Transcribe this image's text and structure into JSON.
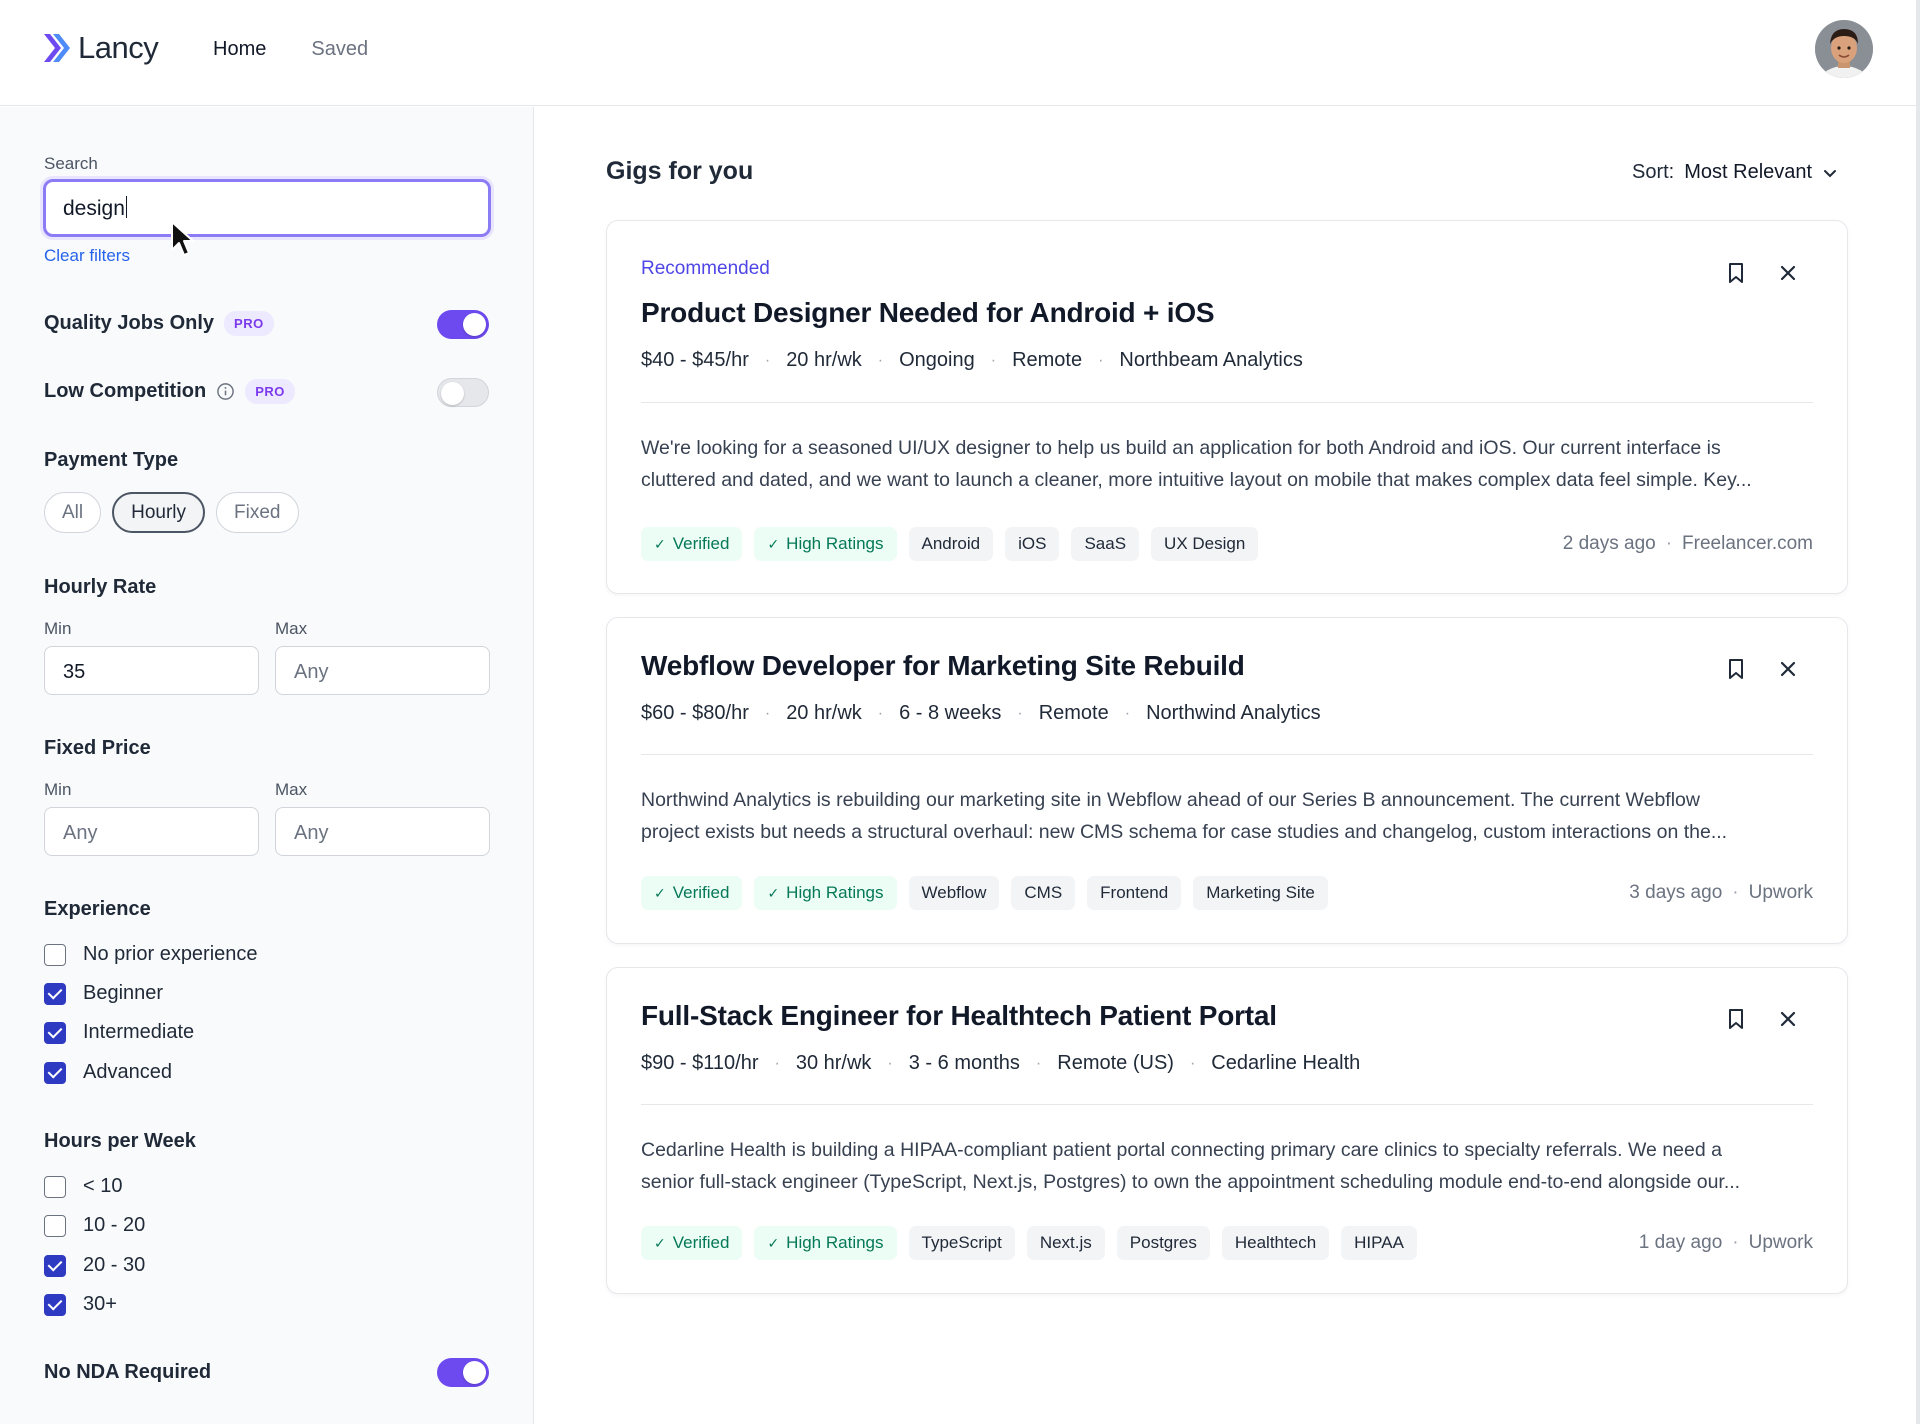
{
  "app": {
    "name": "Lancy"
  },
  "nav": {
    "items": [
      "Home",
      "Saved"
    ]
  },
  "filters": {
    "search_label": "Search",
    "search_value": "design",
    "clear_label": "Clear filters",
    "quality_label": "Quality Jobs Only",
    "quality_on": true,
    "low_comp_label": "Low Competition",
    "low_comp_on": false,
    "pro_badge": "PRO",
    "payment_title": "Payment Type",
    "payment_options": [
      "All",
      "Hourly",
      "Fixed"
    ],
    "payment_selected": "Hourly",
    "hourly_title": "Hourly Rate",
    "min_label": "Min",
    "max_label": "Max",
    "hourly_min": "35",
    "hourly_max_placeholder": "Any",
    "fixed_title": "Fixed Price",
    "fixed_min_placeholder": "Any",
    "fixed_max_placeholder": "Any",
    "experience_title": "Experience",
    "experience": [
      {
        "label": "No prior experience",
        "checked": false
      },
      {
        "label": "Beginner",
        "checked": true
      },
      {
        "label": "Intermediate",
        "checked": true
      },
      {
        "label": "Advanced",
        "checked": true
      }
    ],
    "hours_title": "Hours per Week",
    "hours": [
      {
        "label": "< 10",
        "checked": false
      },
      {
        "label": "10 - 20",
        "checked": false
      },
      {
        "label": "20 - 30",
        "checked": true
      },
      {
        "label": "30+",
        "checked": true
      }
    ],
    "nda_label": "No NDA Required",
    "nda_on": true
  },
  "main": {
    "title": "Gigs for you",
    "sort_label": "Sort:",
    "sort_value": "Most Relevant"
  },
  "gigs": [
    {
      "badge": "Recommended",
      "title": "Product Designer Needed for Android + iOS",
      "meta": [
        "$40 - $45/hr",
        "20 hr/wk",
        "Ongoing",
        "Remote",
        "Northbeam Analytics"
      ],
      "desc1": "We're looking for a seasoned UI/UX designer to help us build an application for both Android and iOS. Our current interface is",
      "desc2": "cluttered and dated, and we want to launch a cleaner, more intuitive layout on mobile that makes complex data feel simple. Key...",
      "badges": [
        "Verified",
        "High Ratings"
      ],
      "tags": [
        "Android",
        "iOS",
        "SaaS",
        "UX Design"
      ],
      "posted": "2 days ago",
      "source": "Freelancer.com"
    },
    {
      "title": "Webflow Developer for Marketing Site Rebuild",
      "meta": [
        "$60 - $80/hr",
        "20 hr/wk",
        "6 - 8 weeks",
        "Remote",
        "Northwind Analytics"
      ],
      "desc1": "Northwind Analytics is rebuilding our marketing site in Webflow ahead of our Series B announcement. The current Webflow",
      "desc2": "project exists but needs a structural overhaul: new CMS schema for case studies and changelog, custom interactions on the...",
      "badges": [
        "Verified",
        "High Ratings"
      ],
      "tags": [
        "Webflow",
        "CMS",
        "Frontend",
        "Marketing Site"
      ],
      "posted": "3 days ago",
      "source": "Upwork"
    },
    {
      "title": "Full-Stack Engineer for Healthtech Patient Portal",
      "meta": [
        "$90 - $110/hr",
        "30 hr/wk",
        "3 - 6 months",
        "Remote (US)",
        "Cedarline Health"
      ],
      "desc1": "Cedarline Health is building a HIPAA-compliant patient portal connecting primary care clinics to specialty referrals. We need a",
      "desc2": "senior full-stack engineer (TypeScript, Next.js, Postgres) to own the appointment scheduling module end-to-end alongside our...",
      "badges": [
        "Verified",
        "High Ratings"
      ],
      "tags": [
        "TypeScript",
        "Next.js",
        "Postgres",
        "Healthtech",
        "HIPAA"
      ],
      "posted": "1 day ago",
      "source": "Upwork"
    }
  ],
  "colors": {
    "accent": "#6d4aef",
    "link": "#2563eb",
    "verified_bg": "#ecfdf5",
    "verified_text": "#047857"
  },
  "icons": [
    "logo-chevron-icon",
    "info-icon",
    "chevron-down-icon",
    "bookmark-icon",
    "close-icon",
    "check-icon",
    "mouse-cursor-icon"
  ]
}
